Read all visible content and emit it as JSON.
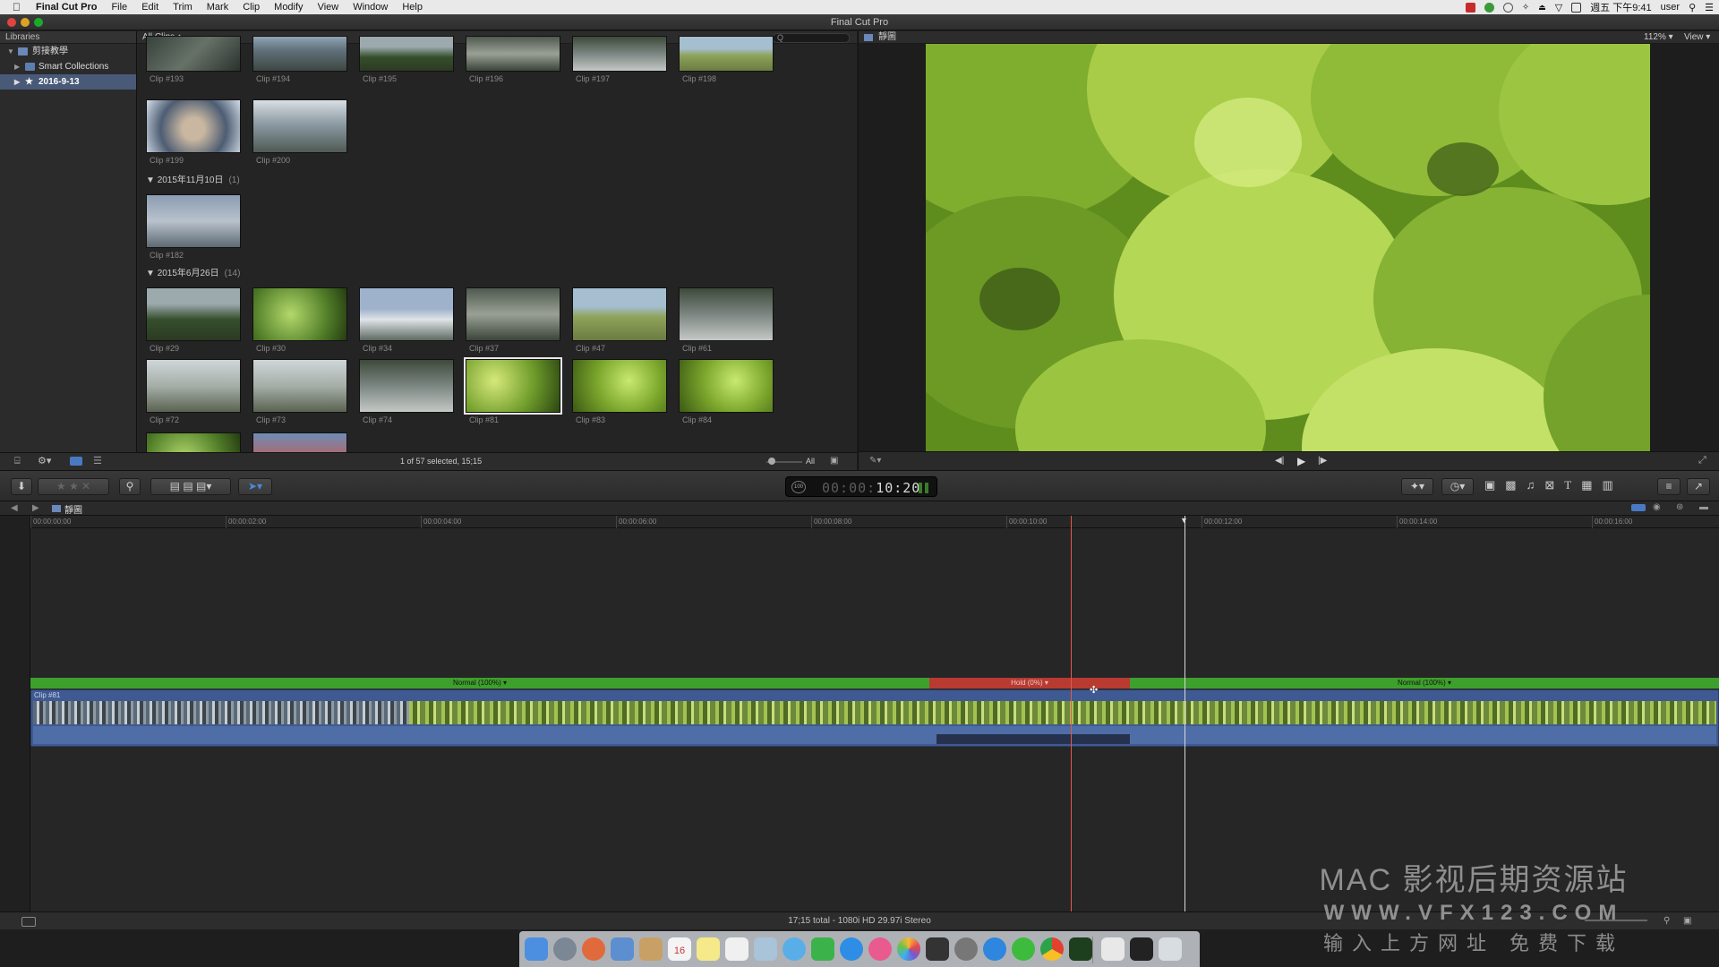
{
  "menubar": {
    "apple": "",
    "items": [
      "Final Cut Pro",
      "File",
      "Edit",
      "Trim",
      "Mark",
      "Clip",
      "Modify",
      "View",
      "Window",
      "Help"
    ],
    "clock": "週五 下午9:41",
    "user": "user"
  },
  "window": {
    "title": "Final Cut Pro"
  },
  "libraries": {
    "header": "Libraries",
    "items": [
      {
        "label": "剪接教學",
        "selected": false
      },
      {
        "label": "Smart Collections",
        "selected": false
      },
      {
        "label": "2016-9-13",
        "selected": true
      }
    ]
  },
  "browser": {
    "filter": "All Clips ↕",
    "search_placeholder": "Q",
    "row1": [
      "Clip #193",
      "Clip #194",
      "Clip #195",
      "Clip #196",
      "Clip #197",
      "Clip #198"
    ],
    "row2": [
      "Clip #199",
      "Clip #200"
    ],
    "section1": {
      "title": "2015年11月10日",
      "count": "(1)"
    },
    "row3": [
      "Clip #182"
    ],
    "section2": {
      "title": "2015年6月26日",
      "count": "(14)"
    },
    "row4": [
      "Clip #29",
      "Clip #30",
      "Clip #34",
      "Clip #37",
      "Clip #47",
      "Clip #61"
    ],
    "row5": [
      "Clip #72",
      "Clip #73",
      "Clip #74",
      "Clip #81",
      "Clip #83",
      "Clip #84"
    ],
    "footer_selection": "1 of 57 selected, 15;15",
    "footer_all": "All"
  },
  "viewer": {
    "title": "靜圖",
    "zoom": "112% ▾",
    "view_menu": "View ▾"
  },
  "toolbar": {
    "timecode_dim": "00:00:",
    "timecode_bright": "10:20",
    "timecode_badge": "100"
  },
  "timeline": {
    "project_name": "靜圖",
    "ruler": [
      "00:00:00:00",
      "00:00:02:00",
      "00:00:04:00",
      "00:00:06:00",
      "00:00:08:00",
      "00:00:10:00",
      "00:00:12:00",
      "00:00:14:00",
      "00:00:16:00"
    ],
    "speed_segments": [
      "Normal (100%) ▾",
      "Hold (0%) ▾",
      "Normal (100%) ▾"
    ],
    "clip_label": "Clip #81",
    "status": "17;15 total - 1080i HD 29.97i Stereo"
  },
  "watermark": {
    "line1": "MAC 影视后期资源站",
    "line2": "WWW.VFX123.COM",
    "line3": "输入上方网址 免费下载"
  },
  "colors": {
    "speed_normal": "#3ea02c",
    "speed_hold": "#b83a30",
    "clip": "#3f5a92",
    "playhead": "#e05a4a"
  }
}
